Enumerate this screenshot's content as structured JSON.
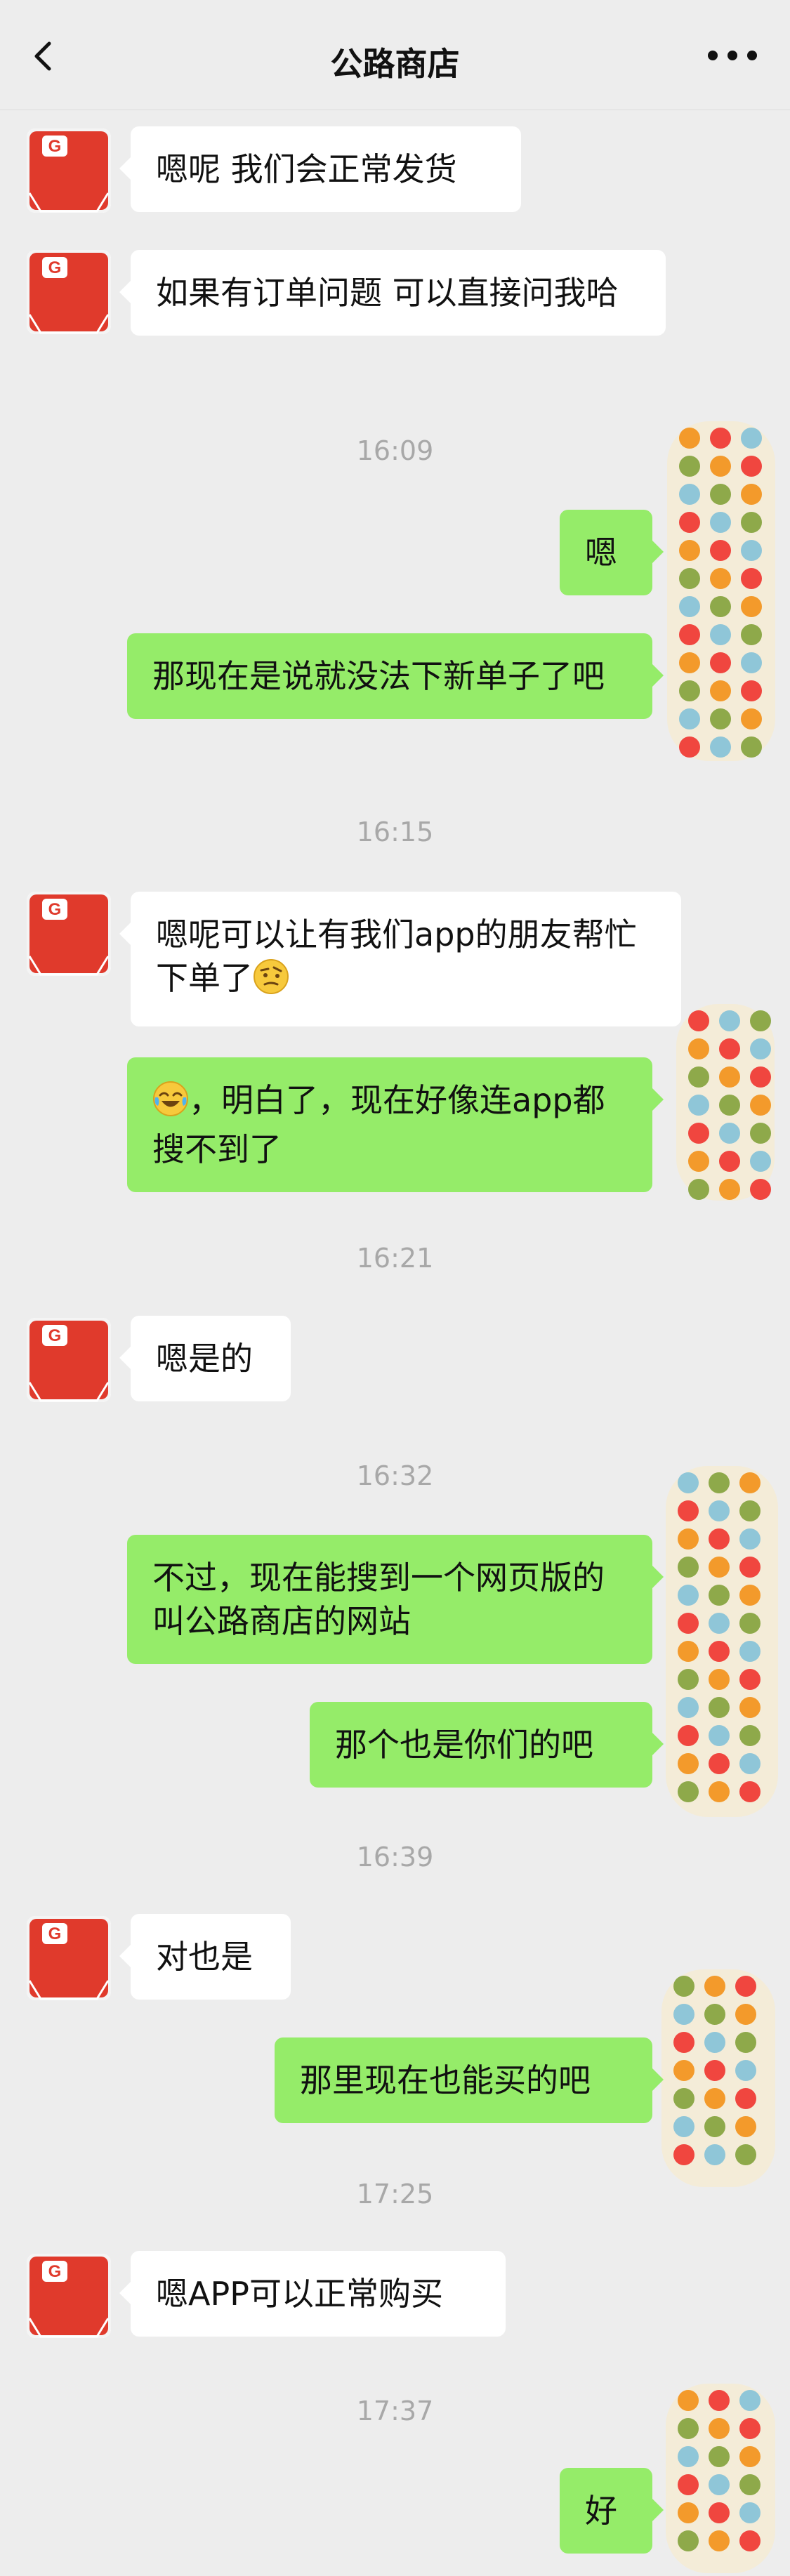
{
  "header": {
    "title": "公路商店",
    "back_icon": "chevron-left-icon",
    "more_icon": "ellipsis-icon"
  },
  "colors": {
    "background": "#ededed",
    "incoming_bubble": "#ffffff",
    "outgoing_bubble": "#95ec69",
    "timestamp": "#a8a8a8",
    "avatar_red": "#e03a2c"
  },
  "messages": [
    {
      "type": "in",
      "text": "嗯呢 我们会正常发货"
    },
    {
      "type": "in",
      "text": "如果有订单问题 可以直接问我哈"
    },
    {
      "type": "time",
      "text": "16:09"
    },
    {
      "type": "out",
      "text": "嗯"
    },
    {
      "type": "out",
      "text": "那现在是说就没法下新单子了吧"
    },
    {
      "type": "time",
      "text": "16:15"
    },
    {
      "type": "in",
      "text": "嗯呢可以让有我们app的朋友帮忙下单了",
      "emoji": "face-with-raised-eyebrow-emoji"
    },
    {
      "type": "out",
      "emoji": "tears-of-joy-emoji",
      "text": "，明白了，现在好像连app都搜不到了"
    },
    {
      "type": "time",
      "text": "16:21"
    },
    {
      "type": "in",
      "text": "嗯是的"
    },
    {
      "type": "time",
      "text": "16:32"
    },
    {
      "type": "out",
      "text": "不过，现在能搜到一个网页版的叫公路商店的网站"
    },
    {
      "type": "out",
      "text": "那个也是你们的吧"
    },
    {
      "type": "time",
      "text": "16:39"
    },
    {
      "type": "in",
      "text": "对也是"
    },
    {
      "type": "out",
      "text": "那里现在也能买的吧"
    },
    {
      "type": "time",
      "text": "17:25"
    },
    {
      "type": "in",
      "text": "嗯APP可以正常购买"
    },
    {
      "type": "time",
      "text": "17:37"
    },
    {
      "type": "out",
      "text": "好"
    }
  ]
}
